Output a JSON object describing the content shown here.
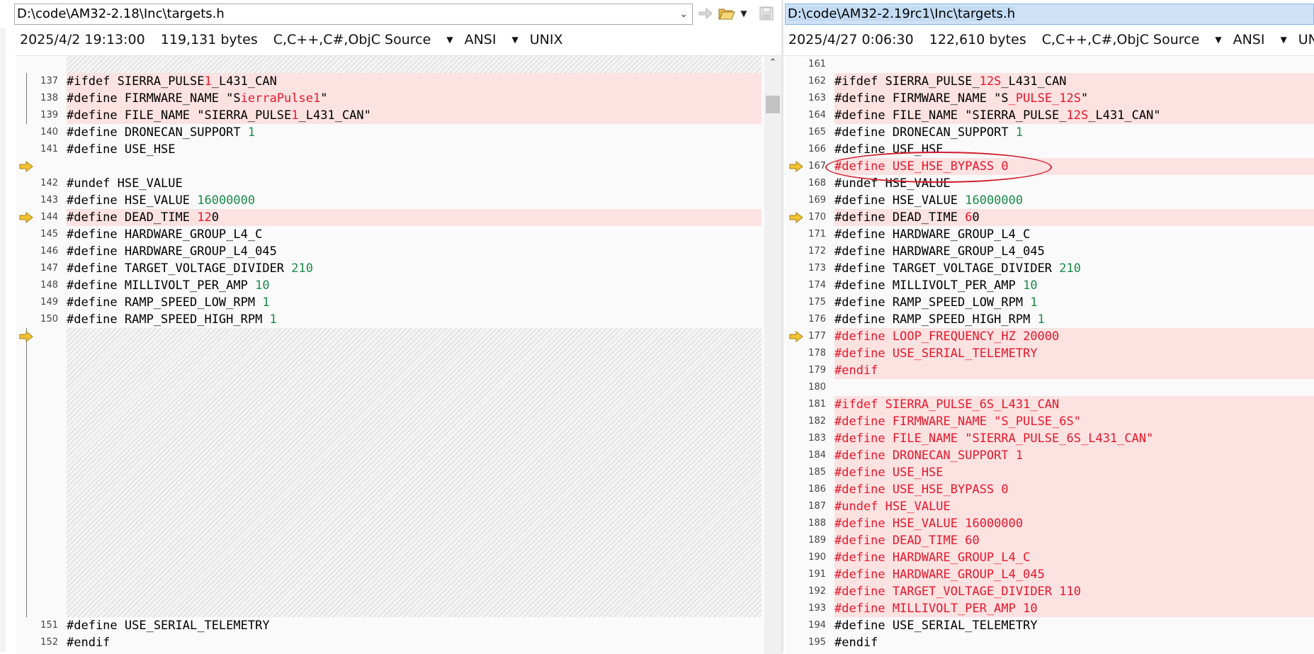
{
  "left": {
    "path": "D:\\code\\AM32-2.18\\Inc\\targets.h",
    "date": "2025/4/2 19:13:00",
    "size": "119,131 bytes",
    "lang": "C,C++,C#,ObjC Source",
    "encoding": "ANSI",
    "eol": "UNIX",
    "lines": [
      {
        "n": "137",
        "segs": [
          {
            "t": "#ifdef SIERRA_PULSE"
          },
          {
            "t": "1",
            "c": "red"
          },
          {
            "t": "_L431_CAN"
          }
        ]
      },
      {
        "n": "138",
        "segs": [
          {
            "t": "#define FIRMWARE_NAME \"S"
          },
          {
            "t": "ierraPulse1",
            "c": "red"
          },
          {
            "t": "\""
          }
        ]
      },
      {
        "n": "139",
        "segs": [
          {
            "t": "#define FILE_NAME \"SIERRA_PULSE"
          },
          {
            "t": "1",
            "c": "red"
          },
          {
            "t": "_L431_CAN\""
          }
        ]
      },
      {
        "n": "140",
        "segs": [
          {
            "t": "#define DRONECAN_SUPPORT "
          },
          {
            "t": "1",
            "c": "num"
          }
        ]
      },
      {
        "n": "141",
        "segs": [
          {
            "t": "#define USE_HSE"
          }
        ]
      },
      {
        "n": "142",
        "segs": [
          {
            "t": "#undef HSE_VALUE"
          }
        ]
      },
      {
        "n": "143",
        "segs": [
          {
            "t": "#define HSE_VALUE "
          },
          {
            "t": "16000000",
            "c": "num"
          }
        ]
      },
      {
        "n": "144",
        "segs": [
          {
            "t": "#define DEAD_TIME "
          },
          {
            "t": "12",
            "c": "red"
          },
          {
            "t": "0"
          }
        ]
      },
      {
        "n": "145",
        "segs": [
          {
            "t": "#define HARDWARE_GROUP_L4_C"
          }
        ]
      },
      {
        "n": "146",
        "segs": [
          {
            "t": "#define HARDWARE_GROUP_L4_045"
          }
        ]
      },
      {
        "n": "147",
        "segs": [
          {
            "t": "#define TARGET_VOLTAGE_DIVIDER "
          },
          {
            "t": "210",
            "c": "num"
          }
        ]
      },
      {
        "n": "148",
        "segs": [
          {
            "t": "#define MILLIVOLT_PER_AMP "
          },
          {
            "t": "10",
            "c": "num"
          }
        ]
      },
      {
        "n": "149",
        "segs": [
          {
            "t": "#define RAMP_SPEED_LOW_RPM "
          },
          {
            "t": "1",
            "c": "num"
          }
        ]
      },
      {
        "n": "150",
        "segs": [
          {
            "t": "#define RAMP_SPEED_HIGH_RPM "
          },
          {
            "t": "1",
            "c": "num"
          }
        ]
      },
      {
        "n": "151",
        "segs": [
          {
            "t": "#define USE_SERIAL_TELEMETRY"
          }
        ]
      },
      {
        "n": "152",
        "segs": [
          {
            "t": "#endif"
          }
        ]
      }
    ]
  },
  "right": {
    "path": "D:\\code\\AM32-2.19rc1\\Inc\\targets.h",
    "date": "2025/4/27 0:06:30",
    "size": "122,610 bytes",
    "lang": "C,C++,C#,ObjC Source",
    "encoding": "ANSI",
    "eol": "UNIX",
    "lines": [
      {
        "n": "161",
        "segs": [
          {
            "t": ""
          }
        ]
      },
      {
        "n": "162",
        "segs": [
          {
            "t": "#ifdef SIERRA_PULSE_"
          },
          {
            "t": "12S",
            "c": "red"
          },
          {
            "t": "_L431_CAN"
          }
        ]
      },
      {
        "n": "163",
        "segs": [
          {
            "t": "#define FIRMWARE_NAME \"S"
          },
          {
            "t": "_PULSE_12S",
            "c": "red"
          },
          {
            "t": "\""
          }
        ]
      },
      {
        "n": "164",
        "segs": [
          {
            "t": "#define FILE_NAME \"SIERRA_PULSE_"
          },
          {
            "t": "12S",
            "c": "red"
          },
          {
            "t": "_L431_CAN\""
          }
        ]
      },
      {
        "n": "165",
        "segs": [
          {
            "t": "#define DRONECAN_SUPPORT "
          },
          {
            "t": "1",
            "c": "num"
          }
        ]
      },
      {
        "n": "166",
        "segs": [
          {
            "t": "#define USE_HSE"
          }
        ]
      },
      {
        "n": "167",
        "segs": [
          {
            "t": "#define USE_HSE_BYPASS 0"
          }
        ]
      },
      {
        "n": "168",
        "segs": [
          {
            "t": "#undef HSE_VALUE"
          }
        ]
      },
      {
        "n": "169",
        "segs": [
          {
            "t": "#define HSE_VALUE "
          },
          {
            "t": "16000000",
            "c": "num"
          }
        ]
      },
      {
        "n": "170",
        "segs": [
          {
            "t": "#define DEAD_TIME "
          },
          {
            "t": "6",
            "c": "red"
          },
          {
            "t": "0"
          }
        ]
      },
      {
        "n": "171",
        "segs": [
          {
            "t": "#define HARDWARE_GROUP_L4_C"
          }
        ]
      },
      {
        "n": "172",
        "segs": [
          {
            "t": "#define HARDWARE_GROUP_L4_045"
          }
        ]
      },
      {
        "n": "173",
        "segs": [
          {
            "t": "#define TARGET_VOLTAGE_DIVIDER "
          },
          {
            "t": "210",
            "c": "num"
          }
        ]
      },
      {
        "n": "174",
        "segs": [
          {
            "t": "#define MILLIVOLT_PER_AMP "
          },
          {
            "t": "10",
            "c": "num"
          }
        ]
      },
      {
        "n": "175",
        "segs": [
          {
            "t": "#define RAMP_SPEED_LOW_RPM "
          },
          {
            "t": "1",
            "c": "num"
          }
        ]
      },
      {
        "n": "176",
        "segs": [
          {
            "t": "#define RAMP_SPEED_HIGH_RPM "
          },
          {
            "t": "1",
            "c": "num"
          }
        ]
      },
      {
        "n": "177",
        "segs": [
          {
            "t": "#define LOOP_FREQUENCY_HZ 20000"
          }
        ]
      },
      {
        "n": "178",
        "segs": [
          {
            "t": "#define USE_SERIAL_TELEMETRY"
          }
        ]
      },
      {
        "n": "179",
        "segs": [
          {
            "t": "#endif"
          }
        ]
      },
      {
        "n": "180",
        "segs": [
          {
            "t": ""
          }
        ]
      },
      {
        "n": "181",
        "segs": [
          {
            "t": "#ifdef SIERRA_PULSE_6S_L431_CAN"
          }
        ]
      },
      {
        "n": "182",
        "segs": [
          {
            "t": "#define FIRMWARE_NAME \"S_PULSE_6S\""
          }
        ]
      },
      {
        "n": "183",
        "segs": [
          {
            "t": "#define FILE_NAME \"SIERRA_PULSE_6S_L431_CAN\""
          }
        ]
      },
      {
        "n": "184",
        "segs": [
          {
            "t": "#define DRONECAN_SUPPORT 1"
          }
        ]
      },
      {
        "n": "185",
        "segs": [
          {
            "t": "#define USE_HSE"
          }
        ]
      },
      {
        "n": "186",
        "segs": [
          {
            "t": "#define USE_HSE_BYPASS 0"
          }
        ]
      },
      {
        "n": "187",
        "segs": [
          {
            "t": "#undef HSE_VALUE"
          }
        ]
      },
      {
        "n": "188",
        "segs": [
          {
            "t": "#define HSE_VALUE 16000000"
          }
        ]
      },
      {
        "n": "189",
        "segs": [
          {
            "t": "#define DEAD_TIME 60"
          }
        ]
      },
      {
        "n": "190",
        "segs": [
          {
            "t": "#define HARDWARE_GROUP_L4_C"
          }
        ]
      },
      {
        "n": "191",
        "segs": [
          {
            "t": "#define HARDWARE_GROUP_L4_045"
          }
        ]
      },
      {
        "n": "192",
        "segs": [
          {
            "t": "#define TARGET_VOLTAGE_DIVIDER 110"
          }
        ]
      },
      {
        "n": "193",
        "segs": [
          {
            "t": "#define MILLIVOLT_PER_AMP 10"
          }
        ]
      },
      {
        "n": "194",
        "segs": [
          {
            "t": "#define USE_SERIAL_TELEMETRY"
          }
        ]
      },
      {
        "n": "195",
        "segs": [
          {
            "t": "#endif"
          }
        ]
      }
    ]
  },
  "icons": {
    "goto": "goto-arrow-icon",
    "folder": "open-folder-icon",
    "save": "save-disk-icon",
    "diff_marker": "diff-arrow-icon"
  },
  "colors": {
    "diff_bg": "#fde2e2",
    "diff_text": "#e8172a",
    "number": "#1b8a4b",
    "selection": "#cfe2f6",
    "marker": "#f2c230",
    "annotation": "#d11f2e"
  }
}
